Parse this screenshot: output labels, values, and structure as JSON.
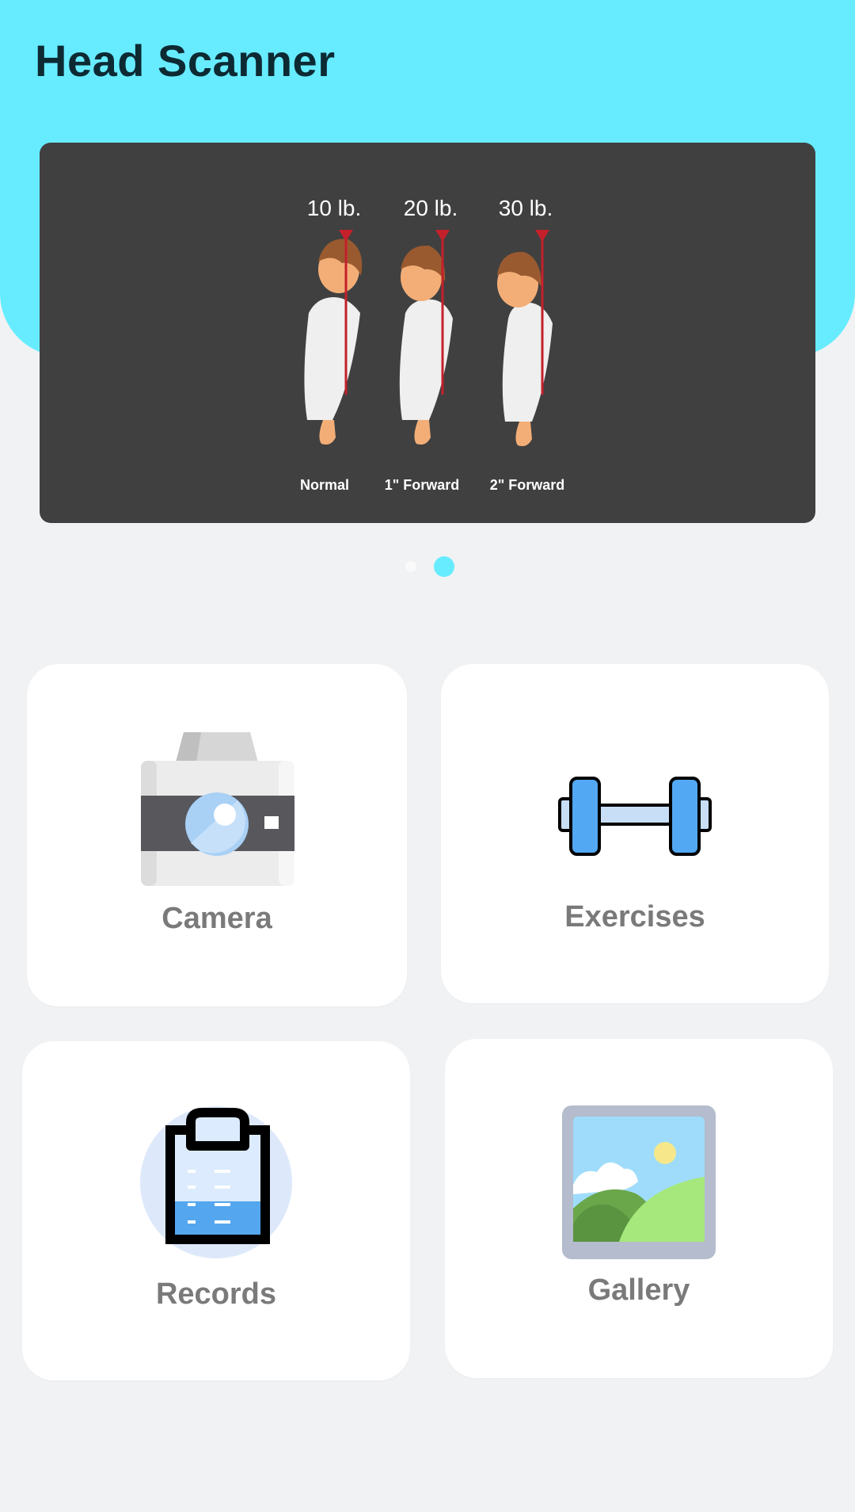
{
  "app": {
    "title": "Head Scanner"
  },
  "banner": {
    "weights": [
      "10 lb.",
      "20 lb.",
      "30 lb."
    ],
    "captions": [
      "Normal",
      "1\" Forward",
      "2\" Forward"
    ],
    "page_count": 2,
    "active_page": 2
  },
  "menu": {
    "camera": {
      "label": "Camera",
      "icon": "camera-icon"
    },
    "exercises": {
      "label": "Exercises",
      "icon": "dumbbell-icon"
    },
    "records": {
      "label": "Records",
      "icon": "clipboard-icon"
    },
    "gallery": {
      "label": "Gallery",
      "icon": "picture-icon"
    }
  },
  "colors": {
    "accent": "#67ecff",
    "background": "#f1f2f4",
    "card": "#ffffff",
    "banner": "#404040",
    "label": "#7a7a7a"
  }
}
